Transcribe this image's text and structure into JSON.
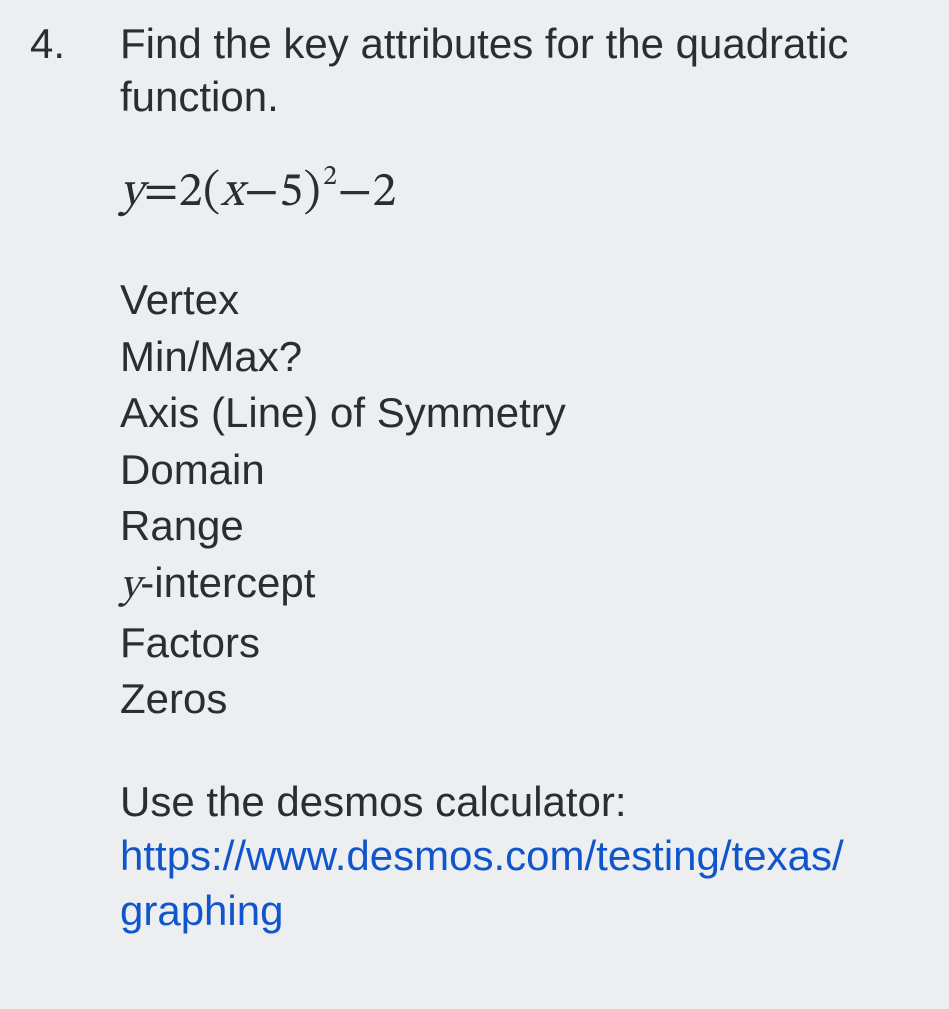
{
  "problem": {
    "number": "4.",
    "prompt": "Find the key attributes for the quadratic function.",
    "equation": {
      "lhs_var": "y",
      "eq": " = ",
      "coef": "2",
      "lparen": "(",
      "inner_var": "x",
      "minus": " − ",
      "h": "5",
      "rparen": ")",
      "exp": "2",
      "tail": "−2"
    },
    "attributes": [
      "Vertex",
      "Min/Max?",
      "Axis (Line) of Symmetry",
      "Domain",
      "Range",
      "y-intercept",
      "Factors",
      "Zeros"
    ],
    "calc_prompt": "Use the desmos calculator:",
    "link_line1": "https://www.desmos.com/testing/texas/",
    "link_line2": "graphing"
  }
}
